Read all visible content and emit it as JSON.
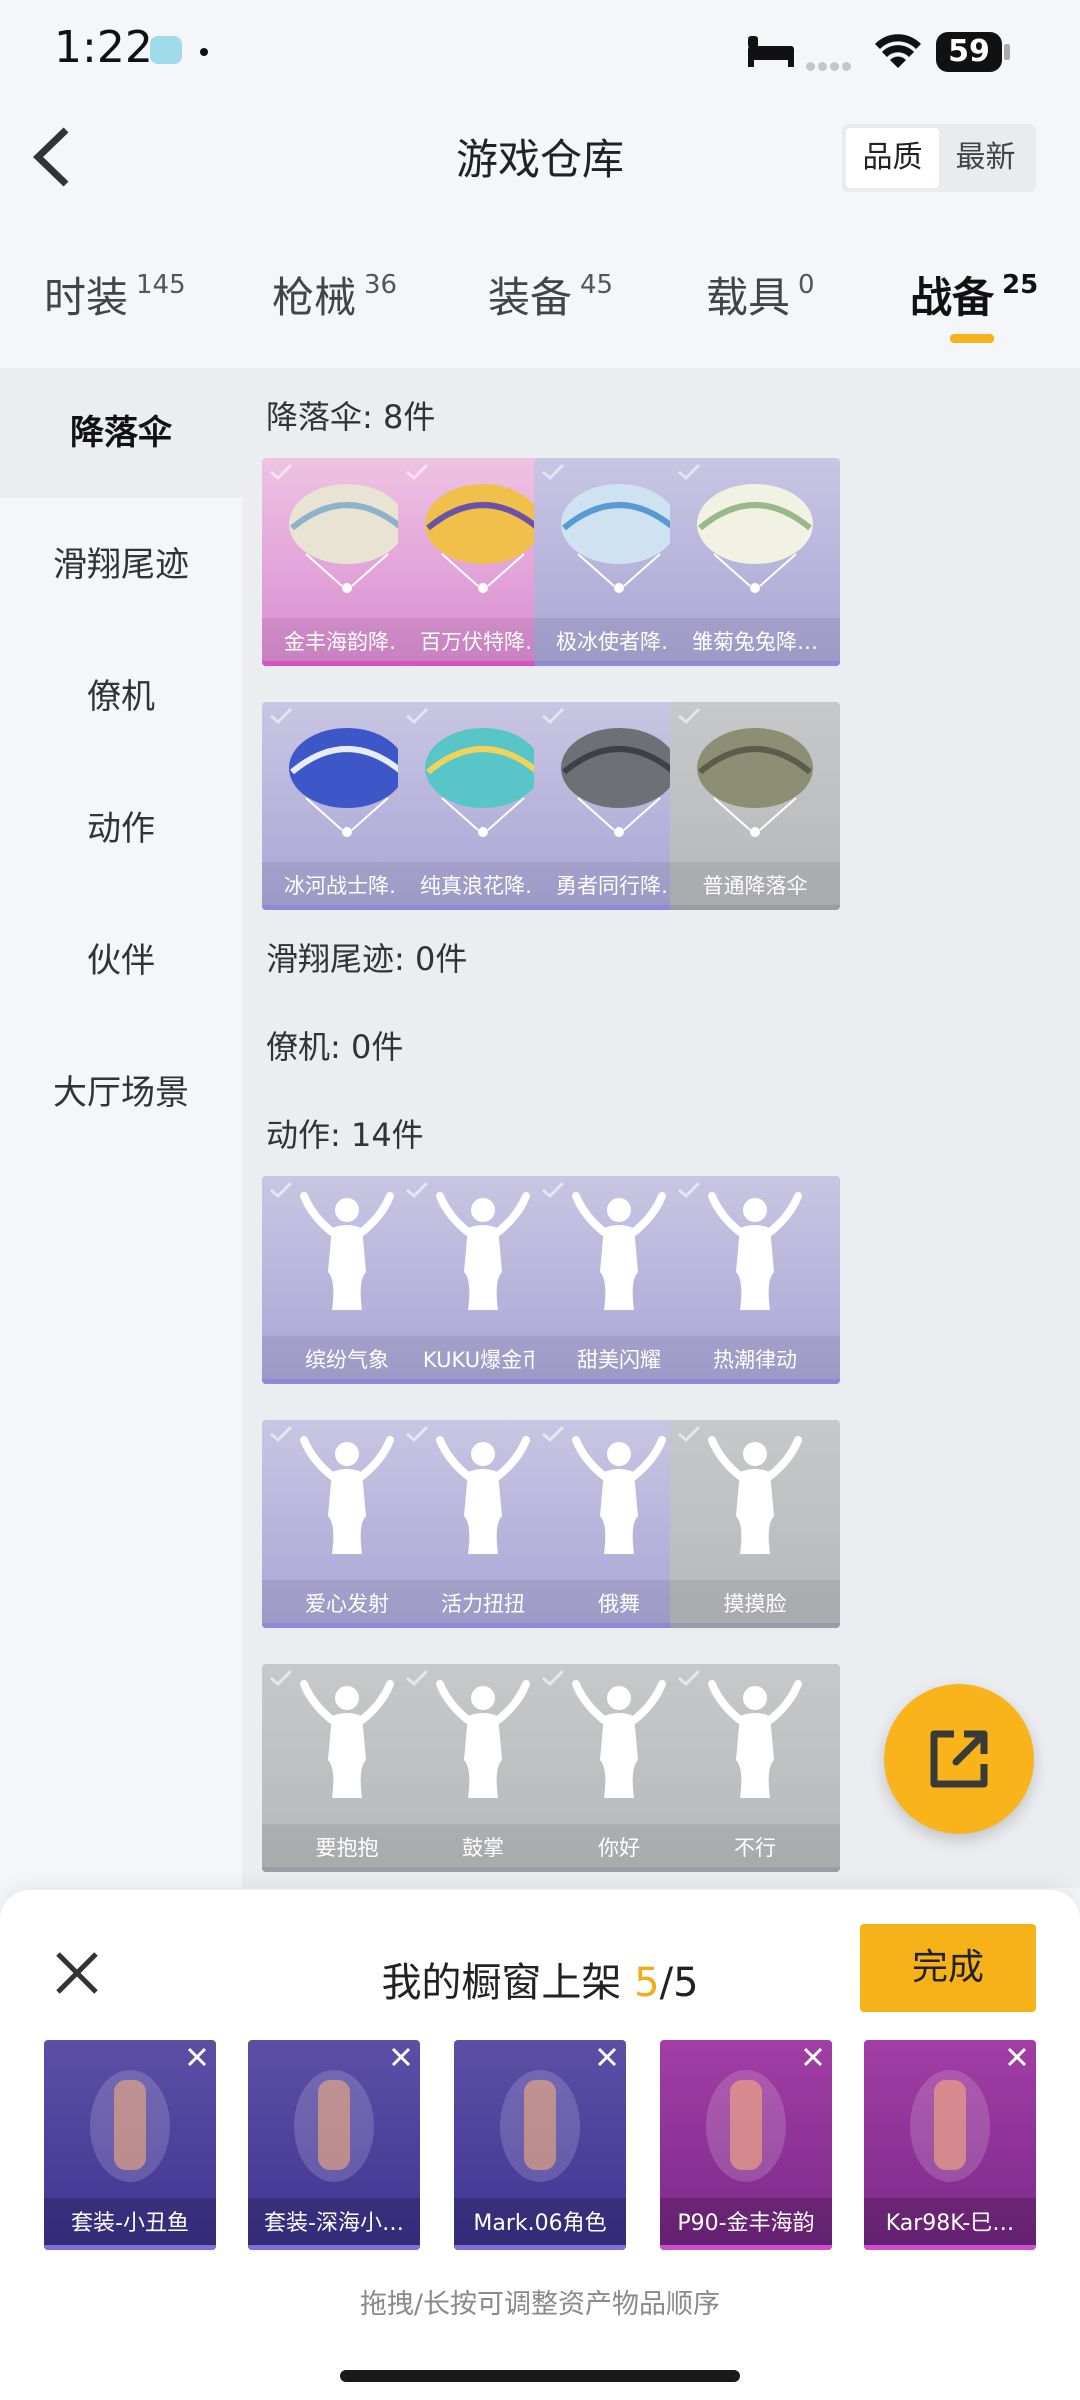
{
  "status_bar": {
    "time": "1:22",
    "battery": "59"
  },
  "header": {
    "title": "游戏仓库",
    "sort_options": [
      "品质",
      "最新"
    ],
    "sort_active": "品质"
  },
  "tabs": [
    {
      "label": "时装",
      "count": "145"
    },
    {
      "label": "枪械",
      "count": "36"
    },
    {
      "label": "装备",
      "count": "45"
    },
    {
      "label": "载具",
      "count": "0"
    },
    {
      "label": "战备",
      "count": "25"
    }
  ],
  "active_tab": "战备",
  "sidebar": [
    {
      "label": "降落伞"
    },
    {
      "label": "滑翔尾迹"
    },
    {
      "label": "僚机"
    },
    {
      "label": "动作"
    },
    {
      "label": "伙伴"
    },
    {
      "label": "大厅场景"
    }
  ],
  "active_sidebar": "降落伞",
  "sections": {
    "parachute": {
      "title": "降落伞: 8件",
      "items": [
        {
          "label": "金丰海韵降…",
          "rarity": "pink"
        },
        {
          "label": "百万伏特降…",
          "rarity": "pink"
        },
        {
          "label": "极冰使者降…",
          "rarity": "purple"
        },
        {
          "label": "雏菊兔兔降…",
          "rarity": "purple"
        },
        {
          "label": "冰河战士降…",
          "rarity": "purple"
        },
        {
          "label": "纯真浪花降…",
          "rarity": "purple"
        },
        {
          "label": "勇者同行降…",
          "rarity": "purple"
        },
        {
          "label": "普通降落伞",
          "rarity": "gray"
        }
      ]
    },
    "trail": {
      "title": "滑翔尾迹: 0件"
    },
    "wingman": {
      "title": "僚机: 0件"
    },
    "emote": {
      "title": "动作: 14件",
      "items": [
        {
          "label": "缤纷气象",
          "rarity": "purple"
        },
        {
          "label": "KUKU爆金币",
          "rarity": "purple"
        },
        {
          "label": "甜美闪耀",
          "rarity": "purple"
        },
        {
          "label": "热潮律动",
          "rarity": "purple"
        },
        {
          "label": "爱心发射",
          "rarity": "purple"
        },
        {
          "label": "活力扭扭",
          "rarity": "purple"
        },
        {
          "label": "俄舞",
          "rarity": "purple"
        },
        {
          "label": "摸摸脸",
          "rarity": "gray"
        },
        {
          "label": "要抱抱",
          "rarity": "gray"
        },
        {
          "label": "鼓掌",
          "rarity": "gray"
        },
        {
          "label": "你好",
          "rarity": "gray"
        },
        {
          "label": "不行",
          "rarity": "gray"
        }
      ]
    }
  },
  "panel": {
    "title": "我的橱窗上架",
    "count": "5",
    "total": "/5",
    "done_label": "完成",
    "hint": "拖拽/长按可调整资产物品顺序",
    "items": [
      {
        "label": "套装-小丑鱼",
        "color": "purple"
      },
      {
        "label": "套装-深海小…",
        "color": "purple"
      },
      {
        "label": "Mark.06角色",
        "color": "purple"
      },
      {
        "label": "P90-金丰海韵",
        "color": "magenta"
      },
      {
        "label": "Kar98K-巳…",
        "color": "magenta"
      }
    ]
  },
  "colors": {
    "accent": "#f7b21a",
    "legendary": "#d255c3",
    "epic": "#8f89d8",
    "common": "#9a9ca6"
  }
}
